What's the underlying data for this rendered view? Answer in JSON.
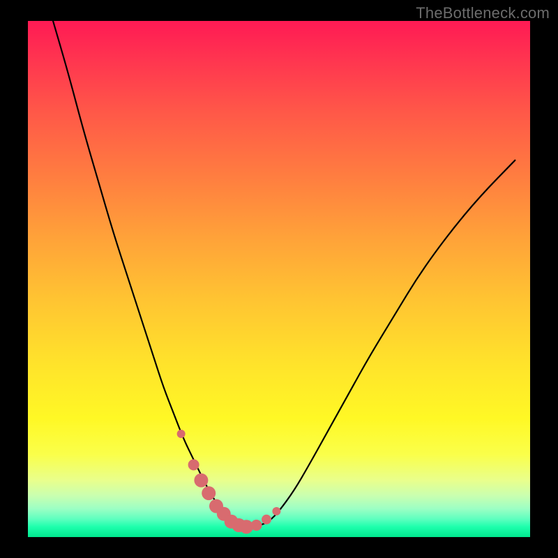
{
  "watermark": "TheBottleneck.com",
  "colors": {
    "background": "#000000",
    "curve": "#000000",
    "marker": "#d86b6f"
  },
  "chart_data": {
    "type": "line",
    "title": "",
    "xlabel": "",
    "ylabel": "",
    "xlim": [
      0,
      100
    ],
    "ylim": [
      0,
      100
    ],
    "grid": false,
    "legend": false,
    "series": [
      {
        "name": "bottleneck-curve",
        "x": [
          5,
          8,
          11,
          14,
          17,
          20,
          23,
          25,
          27,
          29,
          31,
          33,
          35,
          36.5,
          38,
          39.5,
          41,
          42.5,
          44,
          46,
          48,
          50,
          53,
          56,
          60,
          64,
          68,
          73,
          78,
          84,
          90,
          97
        ],
        "y": [
          100,
          90,
          79,
          69,
          59,
          50,
          41,
          35,
          29,
          24,
          19,
          15,
          11,
          8.2,
          6,
          4.2,
          3,
          2.2,
          2,
          2.2,
          3,
          5,
          9,
          14,
          21,
          28,
          35,
          43,
          51,
          59,
          66,
          73
        ]
      }
    ],
    "markers": {
      "name": "highlight-dots",
      "x": [
        30.5,
        33.0,
        34.5,
        36.0,
        37.5,
        39.0,
        40.5,
        42.0,
        43.5,
        45.5,
        47.5,
        49.5
      ],
      "y": [
        20.0,
        14.0,
        11.0,
        8.5,
        6.0,
        4.5,
        3.0,
        2.3,
        2.0,
        2.3,
        3.4,
        5.0
      ],
      "r": [
        6,
        8,
        10,
        10,
        10,
        10,
        10,
        10,
        10,
        8,
        7,
        6
      ]
    }
  }
}
